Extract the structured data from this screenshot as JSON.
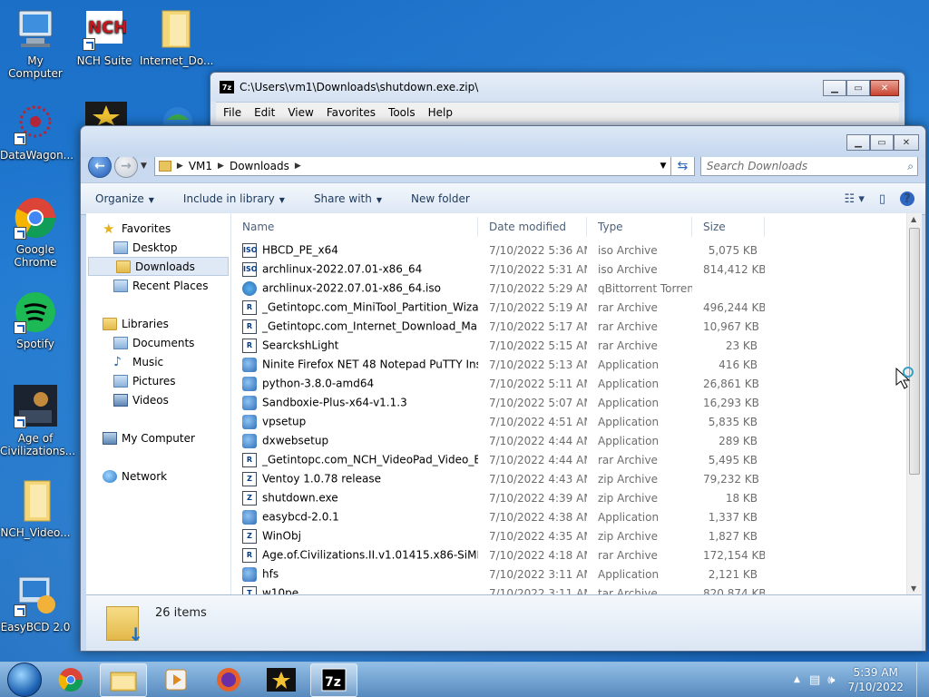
{
  "desktop": {
    "icons": [
      {
        "label": "My Computer",
        "icon": "my-computer-icon"
      },
      {
        "label": "NCH Suite",
        "icon": "nch-suite-icon"
      },
      {
        "label": "Internet_Do...",
        "icon": "folder-icon"
      },
      {
        "label": "DataWagon...",
        "icon": "datawagon-icon"
      },
      {
        "label": "Google Chrome",
        "icon": "chrome-icon"
      },
      {
        "label": "Spotify",
        "icon": "spotify-icon"
      },
      {
        "label": "Age of Civilizations...",
        "icon": "age-of-civilizations-icon"
      },
      {
        "label": "NCH_Video...",
        "icon": "folder-icon"
      },
      {
        "label": "EasyBCD 2.0",
        "icon": "easybcd-icon"
      }
    ]
  },
  "zip_window": {
    "title": "C:\\Users\\vm1\\Downloads\\shutdown.exe.zip\\",
    "app_icon_label": "7z",
    "menu": [
      "File",
      "Edit",
      "View",
      "Favorites",
      "Tools",
      "Help"
    ]
  },
  "explorer": {
    "breadcrumb": [
      "VM1",
      "Downloads"
    ],
    "search_placeholder": "Search Downloads",
    "toolbar": {
      "organize": "Organize",
      "include_in_library": "Include in library",
      "share_with": "Share with",
      "new_folder": "New folder"
    },
    "nav": {
      "favorites": "Favorites",
      "desktop": "Desktop",
      "downloads": "Downloads",
      "recent_places": "Recent Places",
      "libraries": "Libraries",
      "documents": "Documents",
      "music": "Music",
      "pictures": "Pictures",
      "videos": "Videos",
      "my_computer": "My Computer",
      "network": "Network"
    },
    "columns": {
      "name": "Name",
      "date": "Date modified",
      "type": "Type",
      "size": "Size"
    },
    "files": [
      {
        "name": "HBCD_PE_x64",
        "date": "7/10/2022 5:36 AM",
        "type": "iso Archive",
        "size": "5,075 KB",
        "icon": "iso"
      },
      {
        "name": "archlinux-2022.07.01-x86_64",
        "date": "7/10/2022 5:31 AM",
        "type": "iso Archive",
        "size": "814,412 KB",
        "icon": "iso"
      },
      {
        "name": "archlinux-2022.07.01-x86_64.iso",
        "date": "7/10/2022 5:29 AM",
        "type": "qBittorrent Torren...",
        "size": "",
        "icon": "torrent"
      },
      {
        "name": "_Getintopc.com_MiniTool_Partition_Wiza...",
        "date": "7/10/2022 5:19 AM",
        "type": "rar Archive",
        "size": "496,244 KB",
        "icon": "rar"
      },
      {
        "name": "_Getintopc.com_Internet_Download_Ma...",
        "date": "7/10/2022 5:17 AM",
        "type": "rar Archive",
        "size": "10,967 KB",
        "icon": "rar"
      },
      {
        "name": "SearckshLight",
        "date": "7/10/2022 5:15 AM",
        "type": "rar Archive",
        "size": "23 KB",
        "icon": "rar"
      },
      {
        "name": "Ninite Firefox NET 48 Notepad PuTTY Ins...",
        "date": "7/10/2022 5:13 AM",
        "type": "Application",
        "size": "416 KB",
        "icon": "app"
      },
      {
        "name": "python-3.8.0-amd64",
        "date": "7/10/2022 5:11 AM",
        "type": "Application",
        "size": "26,861 KB",
        "icon": "app"
      },
      {
        "name": "Sandboxie-Plus-x64-v1.1.3",
        "date": "7/10/2022 5:07 AM",
        "type": "Application",
        "size": "16,293 KB",
        "icon": "app"
      },
      {
        "name": "vpsetup",
        "date": "7/10/2022 4:51 AM",
        "type": "Application",
        "size": "5,835 KB",
        "icon": "app"
      },
      {
        "name": "dxwebsetup",
        "date": "7/10/2022 4:44 AM",
        "type": "Application",
        "size": "289 KB",
        "icon": "app"
      },
      {
        "name": "_Getintopc.com_NCH_VideoPad_Video_E...",
        "date": "7/10/2022 4:44 AM",
        "type": "rar Archive",
        "size": "5,495 KB",
        "icon": "rar"
      },
      {
        "name": "Ventoy 1.0.78 release",
        "date": "7/10/2022 4:43 AM",
        "type": "zip Archive",
        "size": "79,232 KB",
        "icon": "zip"
      },
      {
        "name": "shutdown.exe",
        "date": "7/10/2022 4:39 AM",
        "type": "zip Archive",
        "size": "18 KB",
        "icon": "zip"
      },
      {
        "name": "easybcd-2.0.1",
        "date": "7/10/2022 4:38 AM",
        "type": "Application",
        "size": "1,337 KB",
        "icon": "app"
      },
      {
        "name": "WinObj",
        "date": "7/10/2022 4:35 AM",
        "type": "zip Archive",
        "size": "1,827 KB",
        "icon": "zip"
      },
      {
        "name": "Age.of.Civilizations.II.v1.01415.x86-SiMPL...",
        "date": "7/10/2022 4:18 AM",
        "type": "rar Archive",
        "size": "172,154 KB",
        "icon": "rar"
      },
      {
        "name": "hfs",
        "date": "7/10/2022 3:11 AM",
        "type": "Application",
        "size": "2,121 KB",
        "icon": "app"
      },
      {
        "name": "w10pe",
        "date": "7/10/2022 3:11 AM",
        "type": "tar Archive",
        "size": "820,874 KB",
        "icon": "tar"
      }
    ],
    "status_count": "26 items"
  },
  "taskbar": {
    "clock_time": "5:39 AM",
    "clock_date": "7/10/2022",
    "apps": [
      "chrome-icon",
      "explorer-icon",
      "media-player-icon",
      "firefox-icon",
      "video-star-icon",
      "7zip-icon"
    ]
  }
}
